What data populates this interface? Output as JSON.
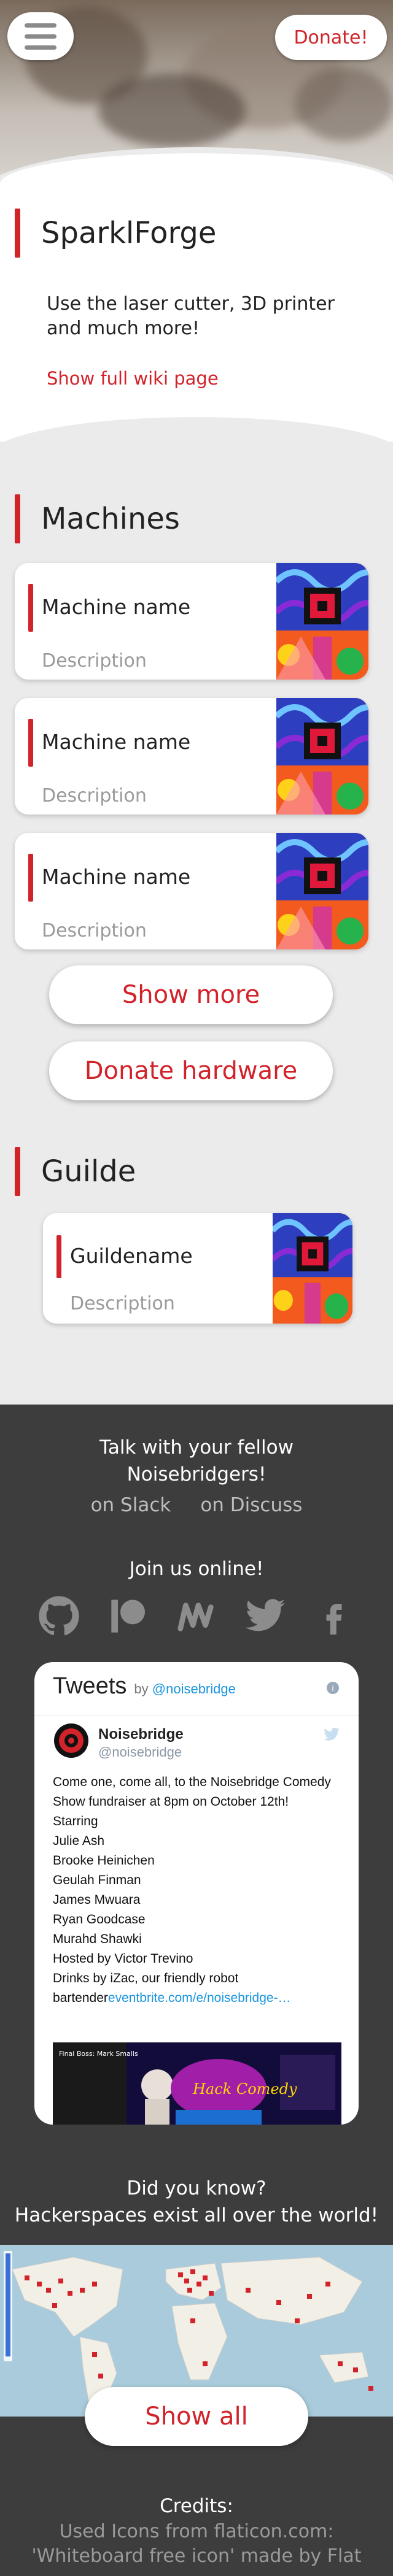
{
  "header": {
    "donate_label": "Donate!"
  },
  "space": {
    "title": "SparklForge",
    "intro": "Use the laser cutter, 3D printer and much more!",
    "wiki_link": "Show full wiki page"
  },
  "machines": {
    "title": "Machines",
    "items": [
      {
        "name": "Machine name",
        "description": "Description"
      },
      {
        "name": "Machine name",
        "description": "Description"
      },
      {
        "name": "Machine name",
        "description": "Description"
      }
    ],
    "show_more": "Show more",
    "donate_hardware": "Donate hardware"
  },
  "guilds": {
    "title": "Guilde",
    "items": [
      {
        "name": "Guildename",
        "description": "Description"
      }
    ]
  },
  "community": {
    "talk_line1": "Talk with your fellow",
    "talk_line2": "Noisebridgers!",
    "slack": "on Slack",
    "discuss": "on Discuss",
    "join": "Join us online!",
    "social_icons": [
      "github-icon",
      "patreon-icon",
      "meetup-icon",
      "twitter-icon",
      "facebook-icon"
    ]
  },
  "tweets": {
    "title": "Tweets",
    "by": "by",
    "handle": "@noisebridge",
    "author_name": "Noisebridge",
    "author_handle": "@noisebridge",
    "lines": [
      "Come one, come all, to the Noisebridge Comedy",
      "Show fundraiser at 8pm on October 12th!",
      "Starring",
      "Julie Ash",
      "Brooke Heinichen",
      "Geulah Finman",
      "James Mwuara",
      "Ryan Goodcase",
      "Murahd Shawki",
      "Hosted by Victor Trevino",
      "Drinks by iZac, our friendly robot"
    ],
    "last_line_prefix": "bartender",
    "last_line_link": "eventbrite.com/e/noisebridge-…",
    "image_title": "Hack Comedy",
    "image_left": "Final Boss: Mark Smalls"
  },
  "hackerspaces": {
    "line1": "Did you know?",
    "line2": "Hackerspaces exist all over the world!",
    "show_all": "Show all"
  },
  "credits": {
    "title": "Credits:",
    "line1": "Used Icons from flaticon.com:",
    "line2": "'Whiteboard free icon' made by Flat"
  },
  "colors": {
    "accent": "#d2222a",
    "dark_bg": "#3d3d3d",
    "link_blue": "#1b95e0"
  }
}
